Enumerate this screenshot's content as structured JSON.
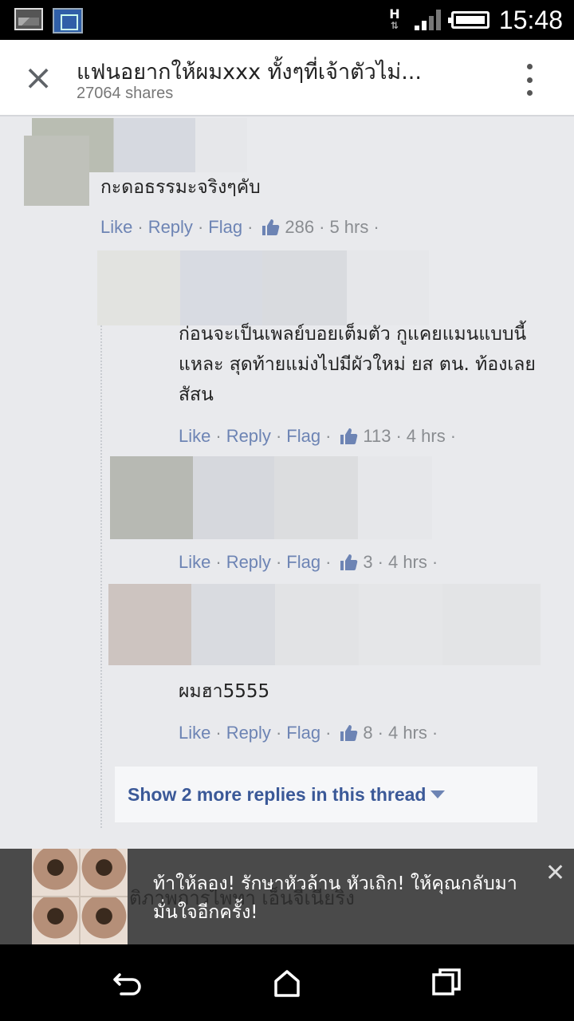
{
  "status_bar": {
    "network_type": "H",
    "time": "15:48",
    "icons": [
      "gallery-icon",
      "film-icon",
      "data-arrows-icon",
      "signal-icon",
      "battery-icon"
    ]
  },
  "header": {
    "title": "แฟนอยากให้ผมxxx ทั้งๆที่เจ้าตัวไม่...",
    "shares": "27064 shares"
  },
  "actions": {
    "like": "Like",
    "reply": "Reply",
    "flag": "Flag",
    "dot": "·"
  },
  "comments": [
    {
      "text": "กะดอธรรมะจริงๆคับ",
      "likes": "286",
      "time": "5 hrs"
    },
    {
      "text": "ก่อนจะเป็นเพลย์บอยเต็มตัว กูแคยแมนแบบนี้แหละ สุดท้ายแม่งไปมีผัวใหม่ ยส ตน. ท้องเลยสัสน",
      "likes": "113",
      "time": "4 hrs"
    },
    {
      "text": "",
      "likes": "3",
      "time": "4 hrs"
    },
    {
      "text": "ผมฮา5555",
      "likes": "8",
      "time": "4 hrs"
    }
  ],
  "more_replies": "Show 2 more replies in this thread",
  "ad": {
    "text": "ท้าให้ลอง! รักษาหัวล้าน หัวเถิก! ให้คุณกลับมามั่นใจอีกครั้ง!",
    "ghost_text": "ติภาพการไพทา เอ็นจีเนียริง"
  },
  "colors": {
    "link": "#6d84b4",
    "button_text": "#3b5998",
    "background": "#e9eaed"
  }
}
